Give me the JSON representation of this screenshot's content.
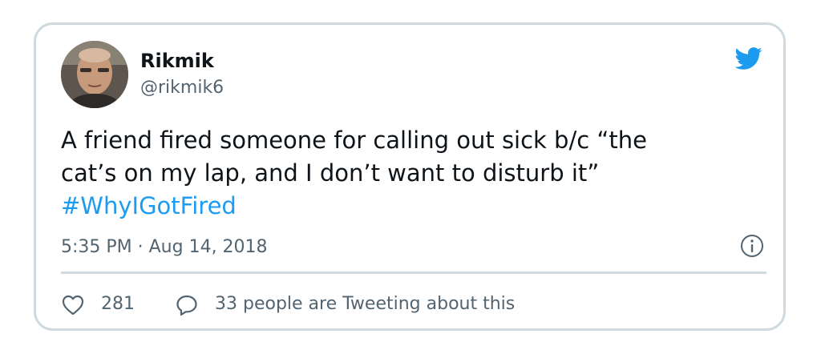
{
  "tweet": {
    "display_name": "Rikmik",
    "handle": "@rikmik6",
    "text_line_1": "A friend fired someone for calling out sick b/c “the",
    "text_line_2": "cat’s on my lap, and I don’t want to disturb it”",
    "hashtag": "#WhyIGotFired",
    "timestamp": "5:35 PM · Aug 14, 2018",
    "like_count": "281",
    "conversation_text": "33 people are Tweeting about this"
  },
  "icons": {
    "brand": "twitter-bird-icon",
    "info": "info-icon",
    "like": "heart-icon",
    "reply": "speech-bubble-icon"
  },
  "colors": {
    "brand_blue": "#1d9bf0",
    "text_primary": "#0f1419",
    "text_secondary": "#536471",
    "border": "#cfd9de"
  }
}
